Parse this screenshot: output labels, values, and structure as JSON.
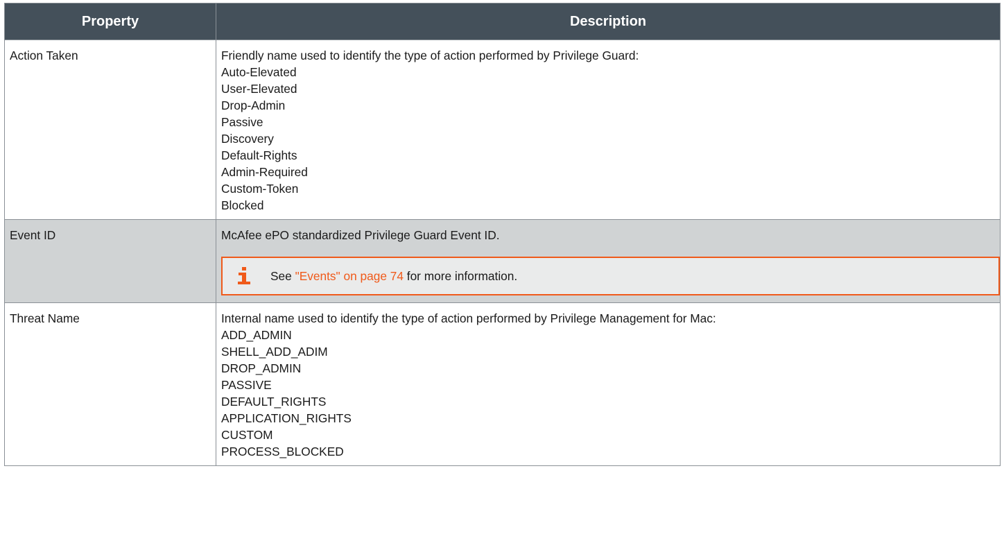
{
  "table": {
    "headers": [
      "Property",
      "Description"
    ],
    "rows": [
      {
        "property": "Action Taken",
        "intro": "Friendly name used to identify the type of action performed by Privilege Guard:",
        "items": [
          "Auto-Elevated",
          "User-Elevated",
          "Drop-Admin",
          "Passive",
          "Discovery",
          "Default-Rights",
          "Admin-Required",
          "Custom-Token",
          "Blocked"
        ]
      },
      {
        "property": "Event ID",
        "intro": "McAfee ePO standardized Privilege Guard Event ID.",
        "note": {
          "icon": "info-icon",
          "prefix": "See ",
          "link": "\"Events\" on page 74",
          "suffix": " for more information."
        }
      },
      {
        "property": "Threat Name",
        "intro": "Internal name used to identify the type of action performed by Privilege Management for Mac:",
        "items": [
          "ADD_ADMIN",
          "SHELL_ADD_ADIM",
          "DROP_ADMIN",
          "PASSIVE",
          "DEFAULT_RIGHTS",
          "APPLICATION_RIGHTS",
          "CUSTOM",
          "PROCESS_BLOCKED"
        ]
      }
    ]
  },
  "colors": {
    "header_bg": "#44505a",
    "alt_row_bg": "#d0d3d4",
    "accent": "#f05a1a"
  }
}
